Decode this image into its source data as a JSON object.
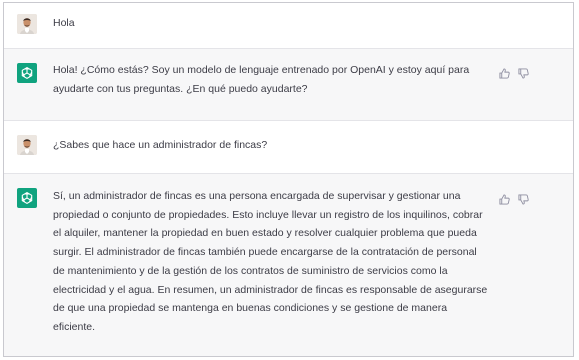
{
  "conversation": {
    "messages": [
      {
        "role": "user",
        "text": "Hola"
      },
      {
        "role": "assistant",
        "text": "Hola! ¿Cómo estás? Soy un modelo de lenguaje entrenado por OpenAI y estoy aquí para ayudarte con tus preguntas. ¿En qué puedo ayudarte?"
      },
      {
        "role": "user",
        "text": "¿Sabes que hace un administrador de fincas?"
      },
      {
        "role": "assistant",
        "text": "Sí, un administrador de fincas es una persona encargada de supervisar y gestionar una propiedad o conjunto de propiedades. Esto incluye llevar un registro de los inquilinos, cobrar el alquiler, mantener la propiedad en buen estado y resolver cualquier problema que pueda surgir. El administrador de fincas también puede encargarse de la contratación de personal de mantenimiento y de la gestión de los contratos de suministro de servicios como la electricidad y el agua. En resumen, un administrador de fincas es responsable de asegurarse de que una propiedad se mantenga en buenas condiciones y se gestione de manera eficiente."
      }
    ]
  },
  "icons": {
    "assistant_avatar": "openai-logo-icon",
    "thumbs_up": "thumbs-up-icon",
    "thumbs_down": "thumbs-down-icon"
  },
  "colors": {
    "assistant_bg": "#f7f7f8",
    "brand": "#10a37f"
  }
}
